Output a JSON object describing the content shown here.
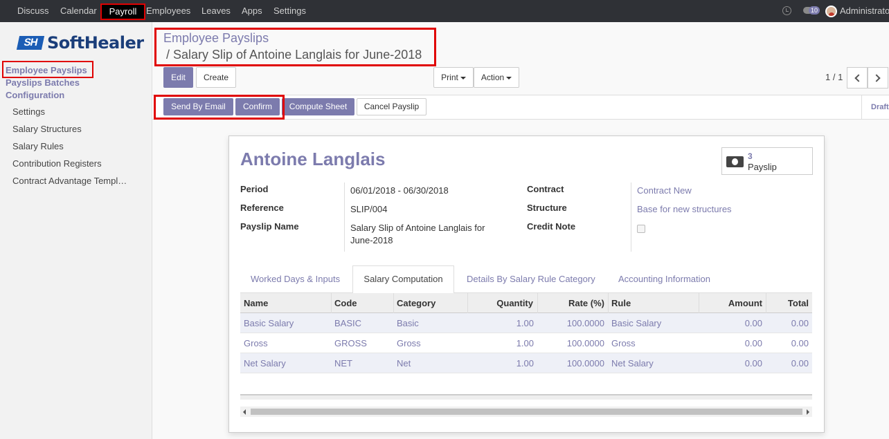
{
  "topbar": {
    "menu": [
      "Discuss",
      "Calendar",
      "Payroll",
      "Employees",
      "Leaves",
      "Apps",
      "Settings"
    ],
    "notification_count": "10",
    "user": "Administrator"
  },
  "sidebar": {
    "logo_mark": "SH",
    "logo_text": "SoftHealer",
    "sections": [
      "Employee Payslips",
      "Payslips Batches",
      "Configuration"
    ],
    "items": [
      "Settings",
      "Salary Structures",
      "Salary Rules",
      "Contribution Registers",
      "Contract Advantage Templ…"
    ]
  },
  "breadcrumb": {
    "parent": "Employee Payslips",
    "current": "/  Salary Slip of Antoine Langlais for June-2018"
  },
  "buttons": {
    "edit": "Edit",
    "create": "Create",
    "print": "Print",
    "action": "Action",
    "pager": "1 / 1"
  },
  "status_actions": {
    "send_email": "Send By Email",
    "confirm": "Confirm",
    "compute": "Compute Sheet",
    "cancel": "Cancel Payslip",
    "state": "Draft"
  },
  "form": {
    "employee": "Antoine Langlais",
    "smart_count": "3",
    "smart_label": "Payslip",
    "period_label": "Period",
    "period": "06/01/2018 - 06/30/2018",
    "reference_label": "Reference",
    "reference": "SLIP/004",
    "name_label": "Payslip Name",
    "name_line1": "Salary Slip of Antoine Langlais for",
    "name_line2": "June-2018",
    "contract_label": "Contract",
    "contract": "Contract New",
    "structure_label": "Structure",
    "structure": "Base for new structures",
    "credit_label": "Credit Note"
  },
  "tabs": [
    "Worked Days & Inputs",
    "Salary Computation",
    "Details By Salary Rule Category",
    "Accounting Information"
  ],
  "table": {
    "headers": [
      "Name",
      "Code",
      "Category",
      "Quantity",
      "Rate (%)",
      "Rule",
      "Amount",
      "Total"
    ],
    "rows": [
      [
        "Basic Salary",
        "BASIC",
        "Basic",
        "1.00",
        "100.0000",
        "Basic Salary",
        "0.00",
        "0.00"
      ],
      [
        "Gross",
        "GROSS",
        "Gross",
        "1.00",
        "100.0000",
        "Gross",
        "0.00",
        "0.00"
      ],
      [
        "Net Salary",
        "NET",
        "Net",
        "1.00",
        "100.0000",
        "Net Salary",
        "0.00",
        "0.00"
      ]
    ]
  }
}
